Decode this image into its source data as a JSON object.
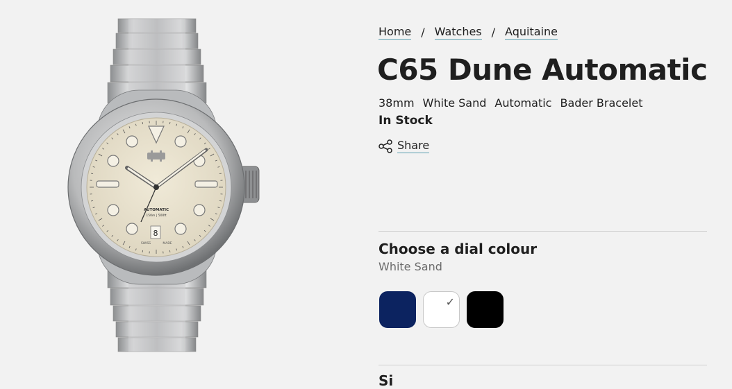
{
  "breadcrumb": {
    "items": [
      "Home",
      "Watches",
      "Aquitaine"
    ],
    "separator": "/"
  },
  "product": {
    "title": "C65 Dune Automatic",
    "specs": [
      "38mm",
      "White Sand",
      "Automatic",
      "Bader Bracelet"
    ],
    "stock": "In Stock",
    "share_label": "Share"
  },
  "watch_image": {
    "dial_text_top": "AUTOMATIC",
    "dial_text_depth": "150m | 500ft",
    "dial_text_bottom": "SWISS",
    "dial_text_bottom2": "MADE",
    "date": "8"
  },
  "dial_colour": {
    "heading": "Choose a dial colour",
    "selected": "White Sand",
    "swatches": [
      {
        "name": "Navy",
        "color": "#0c2360",
        "selected": false
      },
      {
        "name": "White Sand",
        "color": "#ffffff",
        "selected": true
      },
      {
        "name": "Black",
        "color": "#000000",
        "selected": false
      }
    ],
    "check_icon": "checkmark-icon"
  },
  "next_section": {
    "heading": "Si"
  }
}
